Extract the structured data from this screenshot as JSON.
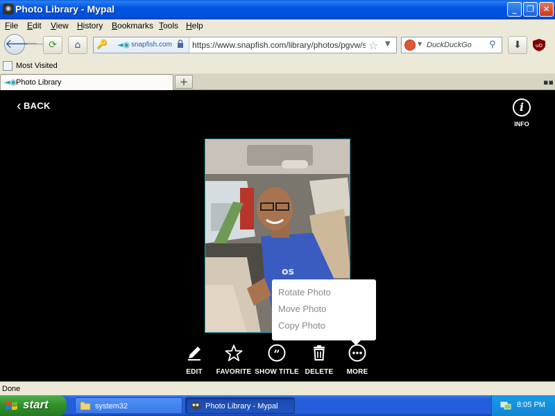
{
  "window": {
    "title": "Photo Library - Mypal",
    "minimize": "_",
    "maximize": "❐",
    "close": "✕"
  },
  "menu": [
    "File",
    "Edit",
    "View",
    "History",
    "Bookmarks",
    "Tools",
    "Help"
  ],
  "navigation": {
    "site_domain": "snapfish.com",
    "url": "https://www.snapfish.com/library/photos/pgvw/siav",
    "search_placeholder": "DuckDuckGo"
  },
  "bookmarks": {
    "most_visited": "Most Visited"
  },
  "tabs": [
    {
      "label": "Photo Library",
      "active": true
    }
  ],
  "viewer": {
    "back_label": "BACK",
    "info_label": "INFO",
    "more_menu": [
      "Rotate Photo",
      "Move Photo",
      "Copy Photo"
    ],
    "actions": [
      {
        "label": "EDIT",
        "icon": "pencil-icon"
      },
      {
        "label": "FAVORITE",
        "icon": "star-icon"
      },
      {
        "label": "SHOW TITLE",
        "icon": "quote-icon"
      },
      {
        "label": "DELETE",
        "icon": "trash-icon"
      },
      {
        "label": "MORE",
        "icon": "ellipsis-icon"
      }
    ]
  },
  "status": {
    "text": "Done"
  },
  "taskbar": {
    "start_label": "start",
    "tasks": [
      {
        "label": "system32",
        "icon": "folder-icon",
        "active": false
      },
      {
        "label": "Photo Library - Mypal",
        "icon": "mypal-icon",
        "active": true
      }
    ],
    "clock": "8:05 PM"
  },
  "colors": {
    "titlebar": "#0054e3",
    "accent_teal": "#2aa3b6",
    "viewer_bg": "#000000",
    "taskbar": "#245edb",
    "start_green": "#3c9a38"
  }
}
